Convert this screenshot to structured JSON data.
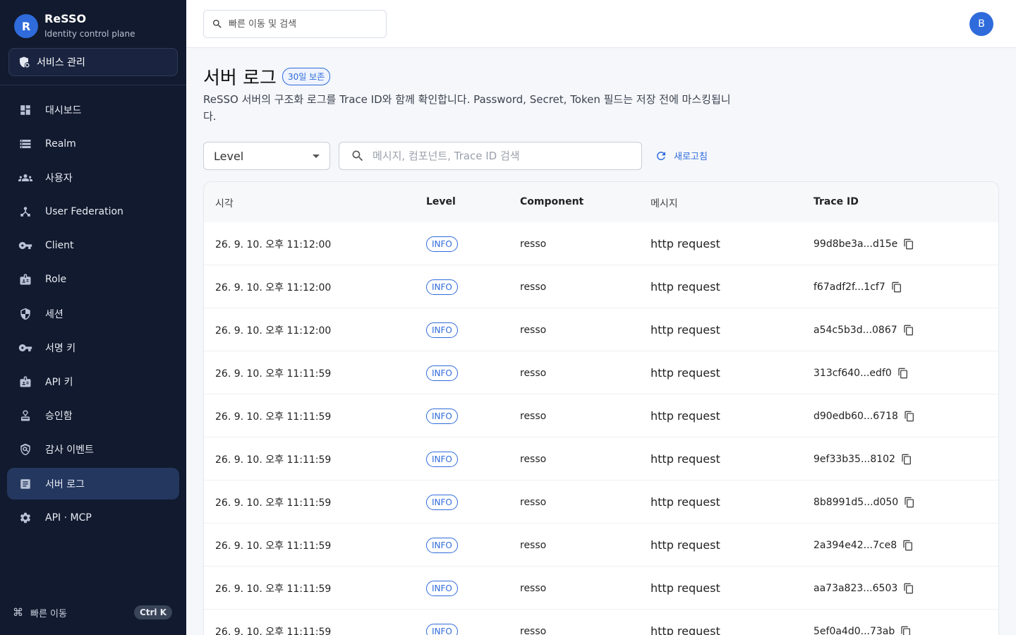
{
  "brand": {
    "logo_letter": "R",
    "name": "ReSSO",
    "subtitle": "Identity control plane"
  },
  "service_button": {
    "label": "서비스 관리",
    "icon": "shield-gear-icon"
  },
  "nav": [
    {
      "label": "대시보드",
      "icon": "dashboard-icon",
      "active": false
    },
    {
      "label": "Realm",
      "icon": "storage-icon",
      "active": false
    },
    {
      "label": "사용자",
      "icon": "people-icon",
      "active": false
    },
    {
      "label": "User Federation",
      "icon": "hierarchy-icon",
      "active": false
    },
    {
      "label": "Client",
      "icon": "key-icon",
      "active": false
    },
    {
      "label": "Role",
      "icon": "badge-icon",
      "active": false
    },
    {
      "label": "세션",
      "icon": "shield-icon",
      "active": false
    },
    {
      "label": "서명 키",
      "icon": "key-icon",
      "active": false
    },
    {
      "label": "API 키",
      "icon": "badge-icon",
      "active": false
    },
    {
      "label": "승인함",
      "icon": "approval-icon",
      "active": false
    },
    {
      "label": "감사 이벤트",
      "icon": "audit-icon",
      "active": false
    },
    {
      "label": "서버 로그",
      "icon": "document-icon",
      "active": true
    },
    {
      "label": "API · MCP",
      "icon": "gear-icon",
      "active": false
    }
  ],
  "quick_nav": {
    "label": "빠른 이동",
    "shortcut": "Ctrl K",
    "icon": "command-icon"
  },
  "topbar": {
    "search_placeholder": "빠른 이동 및 검색",
    "avatar_letter": "B"
  },
  "page": {
    "title": "서버 로그",
    "retention_badge": "30일 보존",
    "description": "ReSSO 서버의 구조화 로그를 Trace ID와 함께 확인합니다. Password, Secret, Token 필드는 저장 전에 마스킹됩니다."
  },
  "filters": {
    "level_label": "Level",
    "search_placeholder": "메시지, 컴포넌트, Trace ID 검색",
    "refresh_label": "새로고침"
  },
  "table": {
    "columns": [
      "시각",
      "Level",
      "Component",
      "메시지",
      "Trace ID"
    ],
    "rows": [
      {
        "time": "26. 9. 10. 오후 11:12:00",
        "level": "INFO",
        "component": "resso",
        "message": "http request",
        "trace": "99d8be3a...d15e"
      },
      {
        "time": "26. 9. 10. 오후 11:12:00",
        "level": "INFO",
        "component": "resso",
        "message": "http request",
        "trace": "f67adf2f...1cf7"
      },
      {
        "time": "26. 9. 10. 오후 11:12:00",
        "level": "INFO",
        "component": "resso",
        "message": "http request",
        "trace": "a54c5b3d...0867"
      },
      {
        "time": "26. 9. 10. 오후 11:11:59",
        "level": "INFO",
        "component": "resso",
        "message": "http request",
        "trace": "313cf640...edf0"
      },
      {
        "time": "26. 9. 10. 오후 11:11:59",
        "level": "INFO",
        "component": "resso",
        "message": "http request",
        "trace": "d90edb60...6718"
      },
      {
        "time": "26. 9. 10. 오후 11:11:59",
        "level": "INFO",
        "component": "resso",
        "message": "http request",
        "trace": "9ef33b35...8102"
      },
      {
        "time": "26. 9. 10. 오후 11:11:59",
        "level": "INFO",
        "component": "resso",
        "message": "http request",
        "trace": "8b8991d5...d050"
      },
      {
        "time": "26. 9. 10. 오후 11:11:59",
        "level": "INFO",
        "component": "resso",
        "message": "http request",
        "trace": "2a394e42...7ce8"
      },
      {
        "time": "26. 9. 10. 오후 11:11:59",
        "level": "INFO",
        "component": "resso",
        "message": "http request",
        "trace": "aa73a823...6503"
      },
      {
        "time": "26. 9. 10. 오후 11:11:59",
        "level": "INFO",
        "component": "resso",
        "message": "http request",
        "trace": "5ef0a4d0...73ab"
      }
    ]
  },
  "colors": {
    "sidebar_bg": "#111a2e",
    "accent": "#2f6bdb",
    "active_nav": "#24375f"
  }
}
